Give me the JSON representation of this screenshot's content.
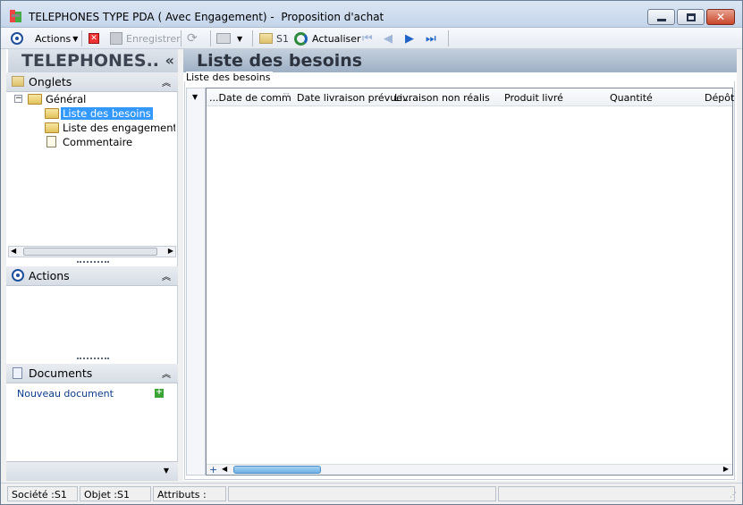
{
  "window": {
    "title": "TELEPHONES TYPE PDA ( Avec Engagement) -  Proposition d'achat"
  },
  "toolbar": {
    "actions_label": "Actions",
    "save_label": "Enregistrer",
    "s1_label": "S1",
    "refresh_label": "Actualiser"
  },
  "left": {
    "big_title": "TELEPHONES..",
    "tabs_header": "Onglets",
    "tree": {
      "root": "Général",
      "items": [
        "Liste des besoins",
        "Liste des engagements",
        "Commentaire"
      ]
    },
    "actions_header": "Actions",
    "documents_header": "Documents",
    "new_document": "Nouveau document"
  },
  "right": {
    "title": "Liste des besoins",
    "group_label": "Liste des besoins",
    "columns": [
      "...Date de comm",
      "Date livraison prévue...",
      "Livraison non réalis",
      "Produit livré",
      "Quantité",
      "Dépôt"
    ]
  },
  "status": {
    "company": "Société :S1",
    "object": "Objet :S1",
    "attributes": "Attributs :"
  },
  "colors": {
    "selection": "#3399ff",
    "accent": "#1f4f9a"
  }
}
